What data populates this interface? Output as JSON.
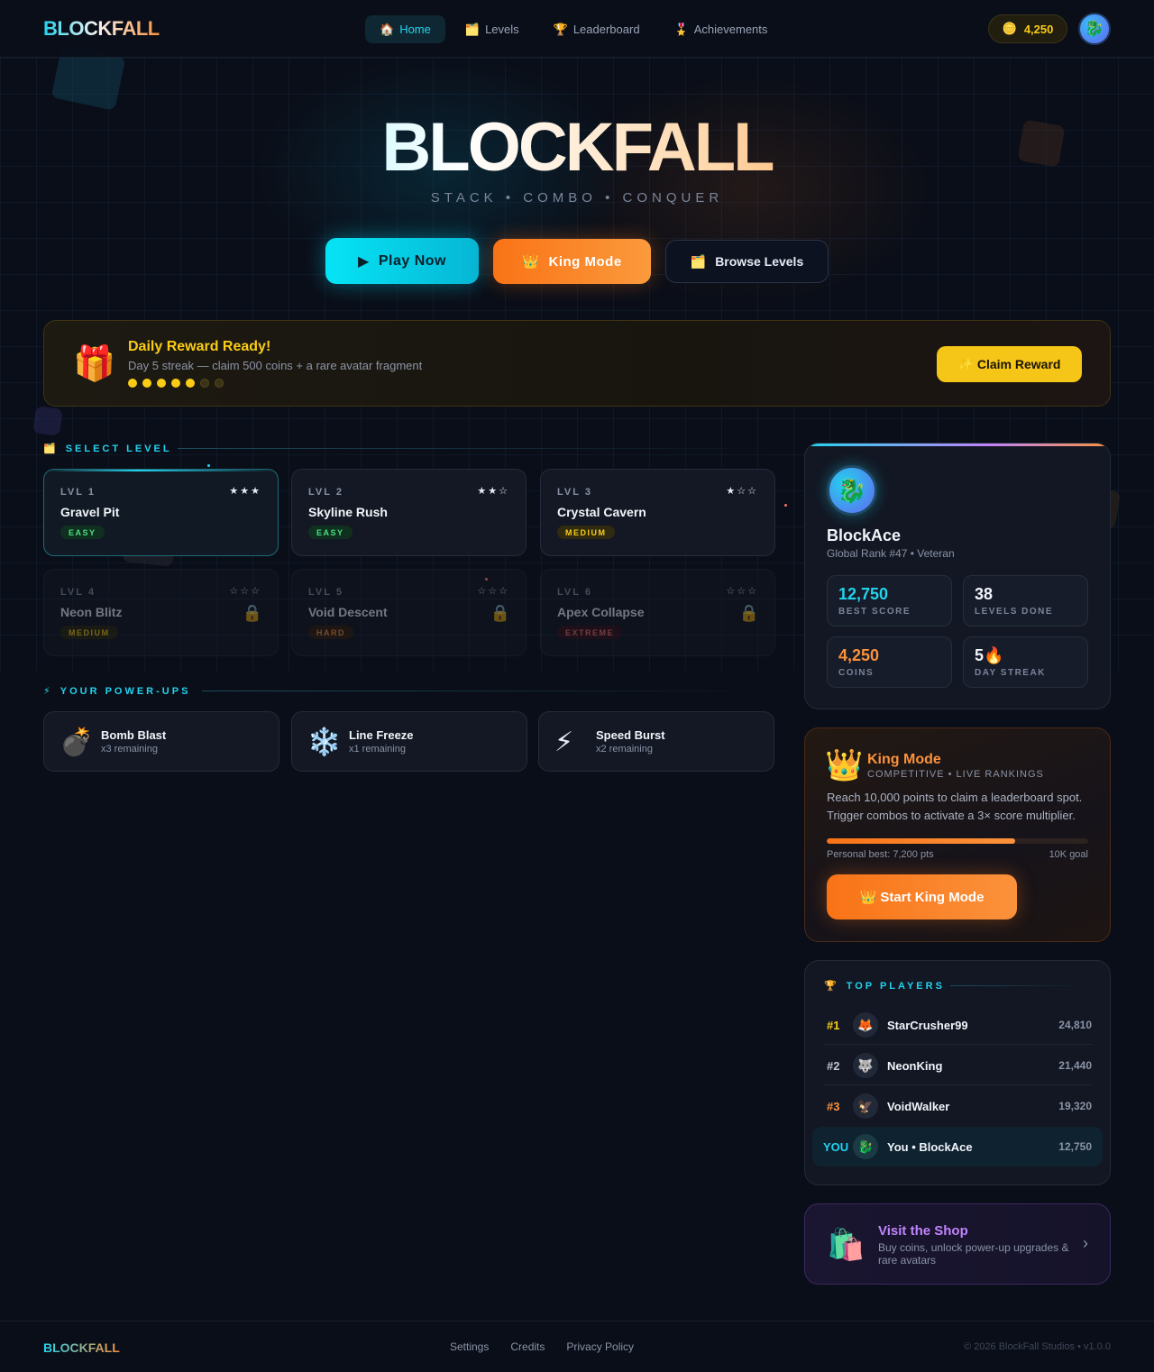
{
  "nav": {
    "logo": "BLOCKFALL",
    "links": [
      {
        "icon": "🏠",
        "label": "Home"
      },
      {
        "icon": "🗂️",
        "label": "Levels"
      },
      {
        "icon": "🏆",
        "label": "Leaderboard"
      },
      {
        "icon": "🎖️",
        "label": "Achievements"
      }
    ],
    "coins": "4,250",
    "coin_icon": "🪙",
    "avatar_icon": "🐉"
  },
  "hero": {
    "title": "BLOCKFALL",
    "subtitle": "STACK • COMBO • CONQUER",
    "play": {
      "icon": "▶",
      "label": "Play Now"
    },
    "king": {
      "icon": "👑",
      "label": "King Mode"
    },
    "browse": {
      "icon": "🗂️",
      "label": "Browse Levels"
    }
  },
  "daily_reward": {
    "icon": "🎁",
    "title": "Daily Reward Ready!",
    "description": "Day 5 streak — claim 500 coins + a rare avatar fragment",
    "streak_days_filled": 5,
    "streak_days_total": 7,
    "button": "✨ Claim Reward"
  },
  "select_level": {
    "icon": "🗂️",
    "heading": "SELECT LEVEL",
    "levels": [
      {
        "num": "LVL 1",
        "name": "Gravel Pit",
        "stars": "★★★",
        "difficulty": "EASY",
        "locked": false
      },
      {
        "num": "LVL 2",
        "name": "Skyline Rush",
        "stars": "★★☆",
        "difficulty": "EASY",
        "locked": false
      },
      {
        "num": "LVL 3",
        "name": "Crystal Cavern",
        "stars": "★☆☆",
        "difficulty": "MEDIUM",
        "locked": false
      },
      {
        "num": "LVL 4",
        "name": "Neon Blitz",
        "stars": "☆☆☆",
        "difficulty": "MEDIUM",
        "locked": true
      },
      {
        "num": "LVL 5",
        "name": "Void Descent",
        "stars": "☆☆☆",
        "difficulty": "HARD",
        "locked": true
      },
      {
        "num": "LVL 6",
        "name": "Apex Collapse",
        "stars": "☆☆☆",
        "difficulty": "EXTREME",
        "locked": true
      }
    ],
    "lock_icon": "🔒"
  },
  "power_ups": {
    "icon": "⚡",
    "heading": "YOUR POWER-UPS",
    "items": [
      {
        "icon": "💣",
        "name": "Bomb Blast",
        "remaining": "x3 remaining"
      },
      {
        "icon": "❄️",
        "name": "Line Freeze",
        "remaining": "x1 remaining"
      },
      {
        "icon": "⚡",
        "name": "Speed Burst",
        "remaining": "x2 remaining"
      }
    ]
  },
  "profile": {
    "avatar_icon": "🐉",
    "name": "BlockAce",
    "rank": "Global Rank #47 • Veteran",
    "stats": [
      {
        "value": "12,750",
        "label": "BEST SCORE",
        "color": "#22d3ee"
      },
      {
        "value": "38",
        "label": "LEVELS DONE",
        "color": "#f1f4fa"
      },
      {
        "value": "4,250",
        "label": "COINS",
        "color": "#fb923c"
      },
      {
        "value": "5🔥",
        "label": "DAY STREAK",
        "color": "#f1f4fa"
      }
    ]
  },
  "king_mode": {
    "icon": "👑",
    "title": "King Mode",
    "subtitle": "COMPETITIVE • LIVE RANKINGS",
    "description": "Reach 10,000 points to claim a leaderboard spot. Trigger combos to activate a 3× score multiplier.",
    "progress": 0.72,
    "personal_best": "Personal best: 7,200 pts",
    "goal": "10K goal",
    "button": "👑 Start King Mode"
  },
  "top_players": {
    "icon": "🏆",
    "heading": "TOP PLAYERS",
    "rows": [
      {
        "pos": "#1",
        "avatar": "🦊",
        "name": "StarCrusher99",
        "score": "24,810",
        "pos_color": "#facc15",
        "you": false
      },
      {
        "pos": "#2",
        "avatar": "🐺",
        "name": "NeonKing",
        "score": "21,440",
        "pos_color": "#c0c7d4",
        "you": false
      },
      {
        "pos": "#3",
        "avatar": "🦅",
        "name": "VoidWalker",
        "score": "19,320",
        "pos_color": "#fb923c",
        "you": false
      },
      {
        "pos": "YOU",
        "avatar": "🐉",
        "name": "You • BlockAce",
        "score": "12,750",
        "pos_color": "#22d3ee",
        "you": true
      }
    ]
  },
  "shop": {
    "icon": "🛍️",
    "title": "Visit the Shop",
    "description": "Buy coins, unlock power-up upgrades & rare avatars",
    "arrow": "›"
  },
  "footer": {
    "logo": "BLOCKFALL",
    "links": [
      "Settings",
      "Credits",
      "Privacy Policy"
    ],
    "copyright": "© 2026 BlockFall Studios • v1.0.0"
  }
}
